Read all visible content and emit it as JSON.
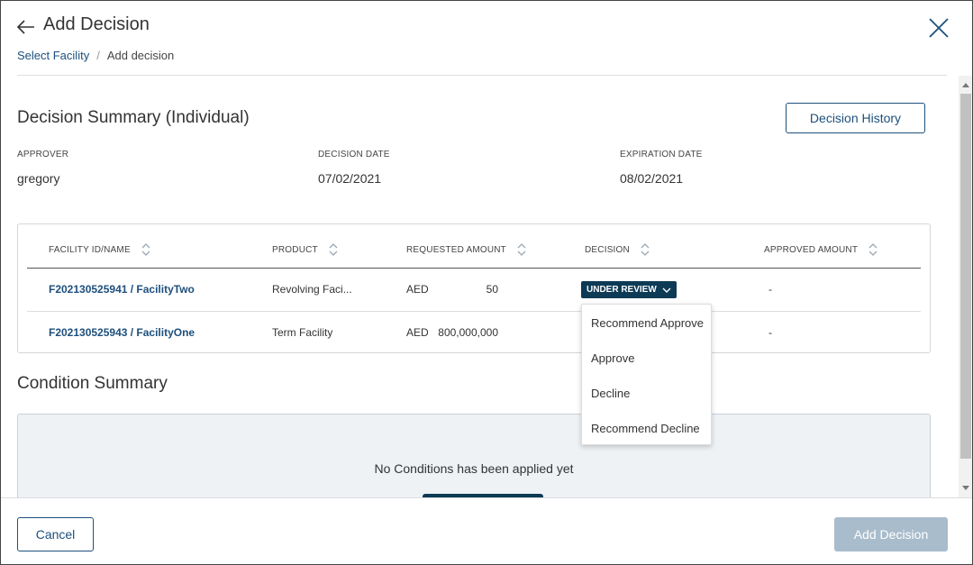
{
  "header": {
    "title": "Add Decision",
    "breadcrumb": {
      "link": "Select Facility",
      "separator": "/",
      "current": "Add decision"
    }
  },
  "summary": {
    "title": "Decision Summary (Individual)",
    "history_button": "Decision History",
    "approver": {
      "label": "APPROVER",
      "value": "gregory"
    },
    "decision_date": {
      "label": "DECISION DATE",
      "value": "07/02/2021"
    },
    "expiration_date": {
      "label": "EXPIRATION DATE",
      "value": "08/02/2021"
    }
  },
  "table": {
    "headers": [
      "FACILITY ID/NAME",
      "PRODUCT",
      "REQUESTED AMOUNT",
      "DECISION",
      "APPROVED AMOUNT"
    ],
    "rows": [
      {
        "facility": "F202130525941 / FacilityTwo",
        "product": "Revolving Faci...",
        "currency": "AED",
        "amount": "50",
        "decision": "UNDER REVIEW",
        "approved": "-"
      },
      {
        "facility": "F202130525943 / FacilityOne",
        "product": "Term Facility",
        "currency": "AED",
        "amount": "800,000,000",
        "decision": "",
        "approved": "-"
      }
    ]
  },
  "decision_menu": {
    "options": [
      "Recommend Approve",
      "Approve",
      "Decline",
      "Recommend Decline"
    ]
  },
  "conditions": {
    "title": "Condition Summary",
    "empty_text": "No Conditions has been applied yet"
  },
  "footer": {
    "cancel": "Cancel",
    "add": "Add Decision"
  },
  "colors": {
    "link": "#1d4f7c",
    "status_bg": "#0d3a55",
    "disabled_btn": "#a9bccc"
  }
}
